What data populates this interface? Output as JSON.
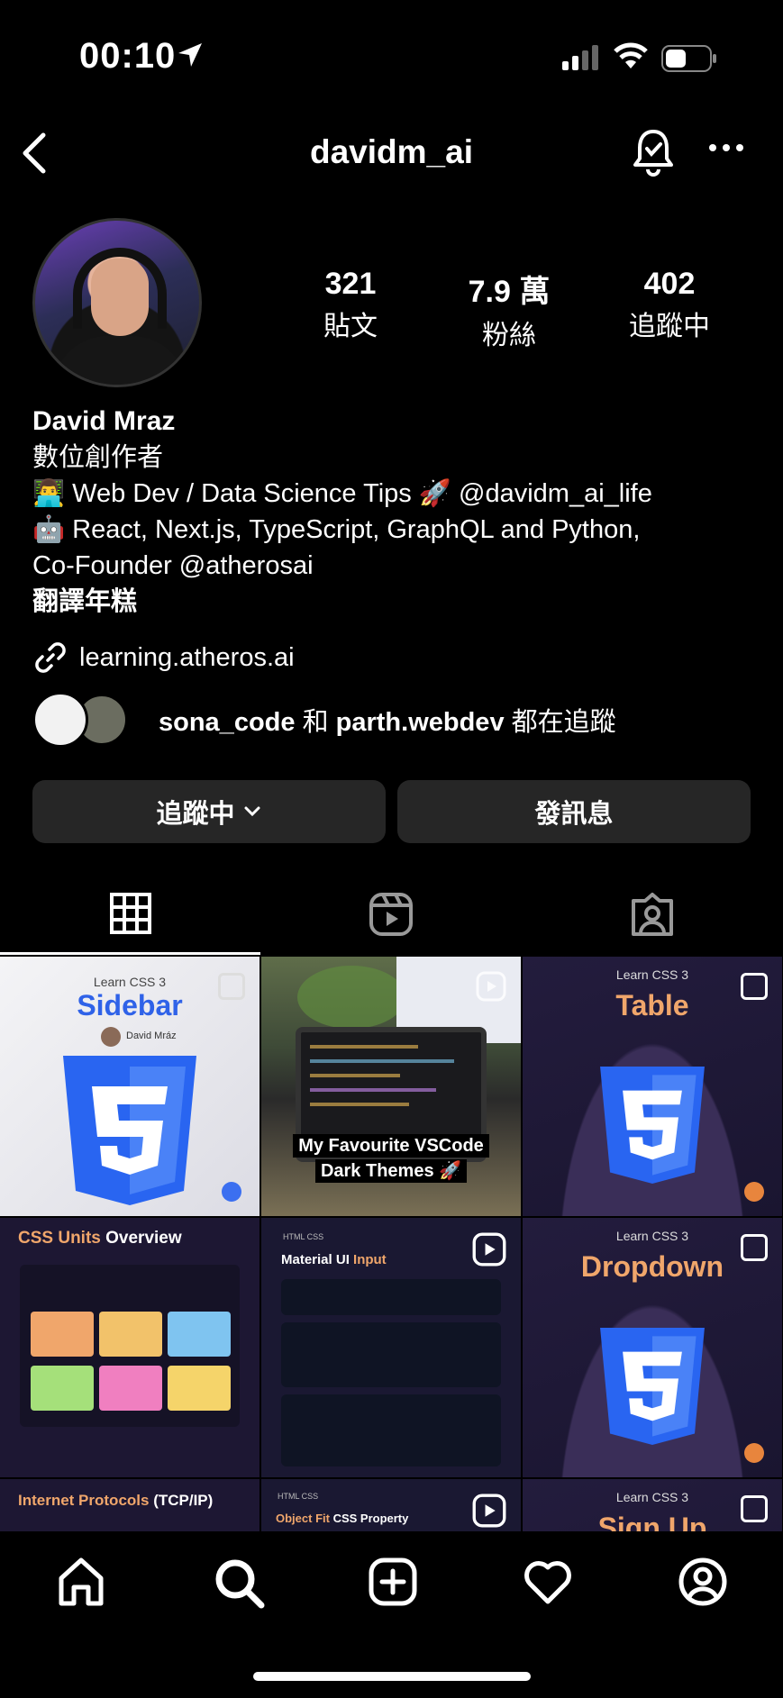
{
  "status_bar": {
    "time": "00:10"
  },
  "header": {
    "username": "davidm_ai"
  },
  "stats": [
    {
      "value": "321",
      "label": "貼文"
    },
    {
      "value": "7.9 萬",
      "label": "粉絲"
    },
    {
      "value": "402",
      "label": "追蹤中"
    }
  ],
  "bio": {
    "name": "David Mraz",
    "category": "數位創作者",
    "line1": "👨‍💻 Web Dev / Data Science Tips 🚀 @davidm_ai_life",
    "line2": "🤖 React, Next.js, TypeScript, GraphQL and Python,",
    "line3": "Co-Founder @atherosai",
    "translate": "翻譯年糕"
  },
  "link": {
    "text": "learning.atheros.ai"
  },
  "followed_by": {
    "user1": "sona_code",
    "and": "和",
    "user2": "parth.webdev",
    "suffix": "都在追蹤"
  },
  "buttons": {
    "following": "追蹤中",
    "message": "發訊息"
  },
  "posts": {
    "p1": {
      "mini": "Learn CSS 3",
      "title": "Sidebar",
      "author": "David Mráz"
    },
    "p2": {
      "caption_line1": "My Favourite VSCode",
      "caption_line2": "Dark Themes 🚀"
    },
    "p3": {
      "mini": "Learn CSS 3",
      "title": "Table"
    },
    "p4": {
      "title_accent": "CSS Units",
      "title_rest": " Overview"
    },
    "p5": {
      "tags": "HTML  CSS",
      "title_plain": "Material UI ",
      "title_accent": "Input"
    },
    "p6": {
      "mini": "Learn CSS 3",
      "title": "Dropdown"
    },
    "p7": {
      "title_accent": "Internet Protocols",
      "title_rest": " (TCP/IP)"
    },
    "p8": {
      "tags": "HTML  CSS",
      "title_accent": "Object Fit",
      "title_rest": " CSS Property"
    },
    "p9": {
      "mini": "Learn CSS 3",
      "title": "Sign Up"
    }
  },
  "colors": {
    "accent_orange": "#f0a66b",
    "css_blue": "#2f62e8",
    "button_bg": "#262626"
  }
}
